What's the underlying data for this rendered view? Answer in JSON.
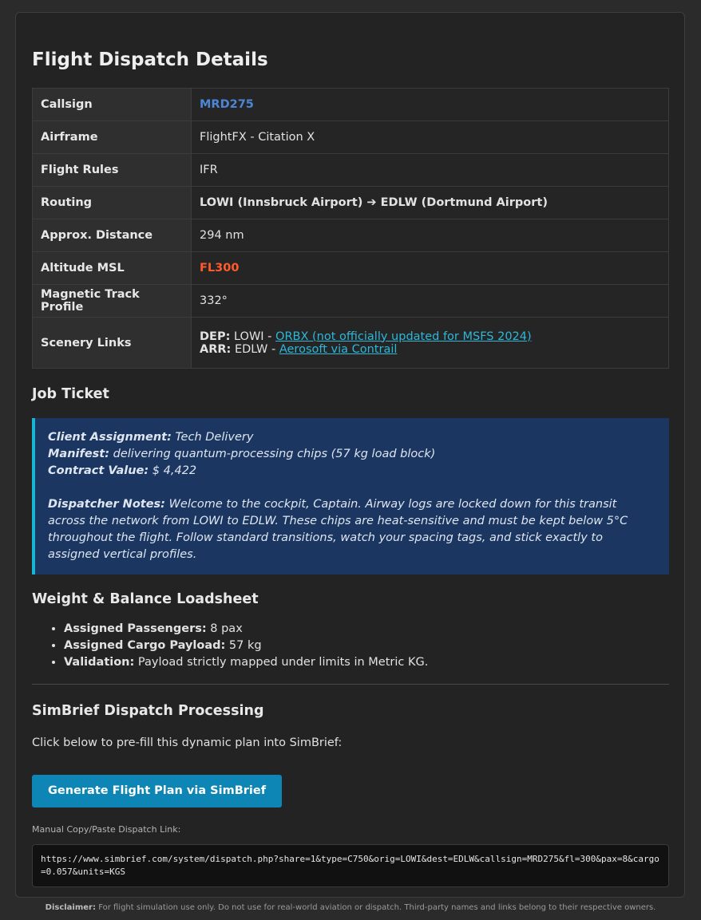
{
  "page": {
    "title": "Flight Dispatch Details"
  },
  "details": {
    "callsign_label": "Callsign",
    "callsign": "MRD275",
    "airframe_label": "Airframe",
    "airframe": "FlightFX - Citation X",
    "rules_label": "Flight Rules",
    "rules": "IFR",
    "routing_label": "Routing",
    "routing": "LOWI (Innsbruck Airport) ➔ EDLW (Dortmund Airport)",
    "distance_label": "Approx. Distance",
    "distance": "294 nm",
    "altitude_label": "Altitude MSL",
    "altitude": "FL300",
    "track_label": "Magnetic Track Profile",
    "track": "332°",
    "scenery_label": "Scenery Links",
    "dep_label": "DEP:",
    "dep_icao": "LOWI",
    "dep_link": "ORBX (not officially updated for MSFS 2024)",
    "arr_label": "ARR:",
    "arr_icao": "EDLW",
    "arr_link": "Aerosoft via Contrail",
    "sep": " - "
  },
  "job": {
    "heading": "Job Ticket",
    "client_label": "Client Assignment:",
    "client": "Tech Delivery",
    "manifest_label": "Manifest:",
    "manifest": "delivering quantum-processing chips (57 kg load block)",
    "contract_label": "Contract Value:",
    "contract": "$ 4,422",
    "notes_label": "Dispatcher Notes:",
    "notes": "Welcome to the cockpit, Captain. Airway logs are locked down for this transit across the network from LOWI to EDLW. These chips are heat-sensitive and must be kept below 5°C throughout the flight. Follow standard transitions, watch your spacing tags, and stick exactly to assigned vertical profiles."
  },
  "wb": {
    "heading": "Weight & Balance Loadsheet",
    "pax_label": "Assigned Passengers:",
    "pax": "8 pax",
    "cargo_label": "Assigned Cargo Payload:",
    "cargo": "57 kg",
    "validation_label": "Validation:",
    "validation": "Payload strictly mapped under limits in Metric KG."
  },
  "simbrief": {
    "heading": "SimBrief Dispatch Processing",
    "intro": "Click below to pre-fill this dynamic plan into SimBrief:",
    "button": "Generate Flight Plan via SimBrief",
    "manual_label": "Manual Copy/Paste Dispatch Link:",
    "link": "https://www.simbrief.com/system/dispatch.php?share=1&type=C750&orig=LOWI&dest=EDLW&callsign=MRD275&fl=300&pax=8&cargo=0.057&units=KGS"
  },
  "footer": {
    "disclaimer_label": "Disclaimer:",
    "disclaimer": "For flight simulation use only. Do not use for real-world aviation or dispatch. Third-party names and links belong to their respective owners."
  },
  "colors": {
    "accent_callsign": "#4d86d6",
    "accent_altitude": "#ff5a2a",
    "link": "#2fb7d8",
    "button": "#0d86b6",
    "ticket_bg": "#1b3660",
    "ticket_border": "#19b6d4"
  }
}
